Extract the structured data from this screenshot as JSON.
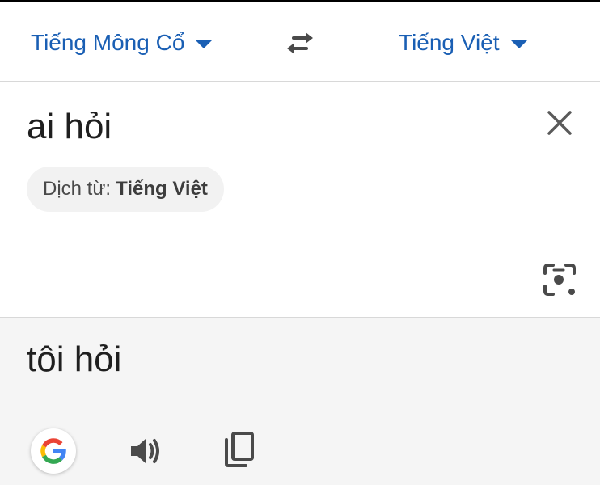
{
  "language_bar": {
    "source_language": "Tiếng Mông Cổ",
    "target_language": "Tiếng Việt",
    "swap_icon": "swap-arrows-icon"
  },
  "input": {
    "text": "ai hỏi",
    "clear_icon": "close-icon",
    "detected_prefix": "Dịch từ:",
    "detected_language": "Tiếng Việt",
    "camera_icon": "camera-icon"
  },
  "output": {
    "text": "tôi hỏi",
    "actions": {
      "google_icon": "google-g-icon",
      "speak_icon": "speaker-icon",
      "copy_icon": "copy-icon"
    }
  },
  "colors": {
    "accent": "#1a5fb4",
    "output_background": "#f5f5f5",
    "chip_background": "#f2f2f2"
  }
}
